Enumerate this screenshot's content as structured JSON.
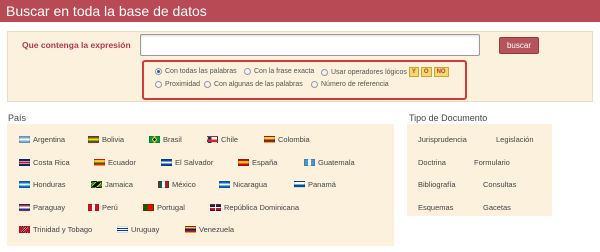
{
  "header": {
    "title": "Buscar en toda la base de datos"
  },
  "search": {
    "label": "Que contenga la expresión",
    "input_value": "",
    "button_label": "buscar"
  },
  "options": {
    "radios": [
      {
        "label": "Con todas las palabras",
        "checked": true
      },
      {
        "label": "Con la frase exacta",
        "checked": false
      },
      {
        "label": "Usar operadores lógicos",
        "checked": false
      },
      {
        "label": "Proximidad",
        "checked": false
      },
      {
        "label": "Con algunas de las palabras",
        "checked": false
      },
      {
        "label": "Número de referencia",
        "checked": false
      }
    ],
    "operators": [
      "Y",
      "O",
      "NO"
    ]
  },
  "pais": {
    "title": "País",
    "countries": [
      {
        "name": "Argentina",
        "flag": "argentina-flag"
      },
      {
        "name": "Bolivia",
        "flag": "bolivia-flag"
      },
      {
        "name": "Brasil",
        "flag": "brasil-flag"
      },
      {
        "name": "Chile",
        "flag": "chile-flag"
      },
      {
        "name": "Colombia",
        "flag": "colombia-flag"
      },
      {
        "name": "Costa Rica",
        "flag": "costa-rica-flag"
      },
      {
        "name": "Ecuador",
        "flag": "ecuador-flag"
      },
      {
        "name": "El Salvador",
        "flag": "el-salvador-flag"
      },
      {
        "name": "España",
        "flag": "espana-flag"
      },
      {
        "name": "Guatemala",
        "flag": "guatemala-flag"
      },
      {
        "name": "Honduras",
        "flag": "honduras-flag"
      },
      {
        "name": "Jamaica",
        "flag": "jamaica-flag"
      },
      {
        "name": "México",
        "flag": "mexico-flag"
      },
      {
        "name": "Nicaragua",
        "flag": "nicaragua-flag"
      },
      {
        "name": "Panamá",
        "flag": "panama-flag"
      },
      {
        "name": "Paraguay",
        "flag": "paraguay-flag"
      },
      {
        "name": "Perú",
        "flag": "peru-flag"
      },
      {
        "name": "Portugal",
        "flag": "portugal-flag"
      },
      {
        "name": "República Dominicana",
        "flag": "republica-dominicana-flag"
      },
      {
        "name": "Trinidad y Tobago",
        "flag": "trinidad-y-tobago-flag"
      },
      {
        "name": "Uruguay",
        "flag": "uruguay-flag"
      },
      {
        "name": "Venezuela",
        "flag": "venezuela-flag"
      }
    ]
  },
  "tipo": {
    "title": "Tipo de Documento",
    "items": [
      "Jurisprudencia",
      "Legislación",
      "Doctrina",
      "Formulario",
      "Bibliografía",
      "Consultas",
      "Esquemas",
      "Gacetas"
    ]
  },
  "colors": {
    "header_bg": "#b84a55",
    "accent": "#b23a44",
    "panel_bg": "#fbf1dd",
    "highlight_border": "#d23a3a"
  }
}
